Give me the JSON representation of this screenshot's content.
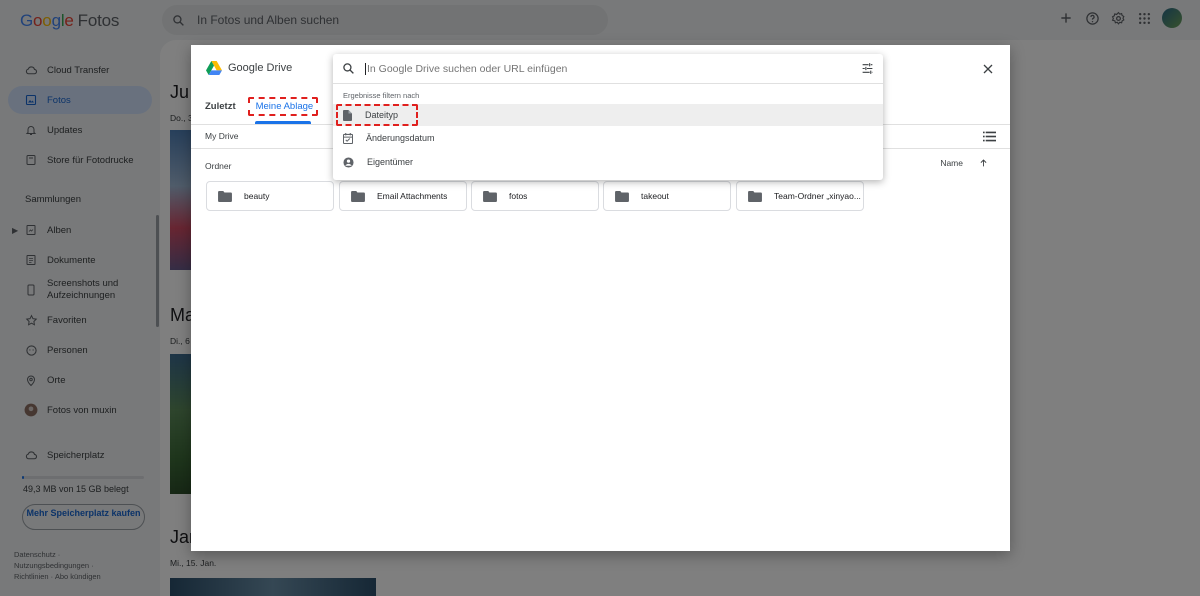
{
  "app": {
    "logo_letters": [
      "G",
      "o",
      "o",
      "g",
      "l",
      "e"
    ],
    "logo_product": "Fotos",
    "search_placeholder": "In Fotos und Alben suchen"
  },
  "sidebar": {
    "items": [
      {
        "label": "Cloud Transfer",
        "icon": "cloud-icon"
      },
      {
        "label": "Fotos",
        "icon": "photo-icon",
        "active": true
      },
      {
        "label": "Updates",
        "icon": "bell-icon"
      },
      {
        "label": "Store für Fotodrucke",
        "icon": "store-icon"
      }
    ],
    "collections_header": "Sammlungen",
    "collections": [
      {
        "label": "Alben",
        "icon": "album-icon"
      },
      {
        "label": "Dokumente",
        "icon": "document-icon"
      },
      {
        "label": "Screenshots und Aufzeichnungen",
        "icon": "phone-icon"
      },
      {
        "label": "Favoriten",
        "icon": "star-icon"
      },
      {
        "label": "Personen",
        "icon": "face-icon"
      },
      {
        "label": "Orte",
        "icon": "location-icon"
      },
      {
        "label": "Fotos von muxin",
        "icon": "avatar-icon"
      }
    ],
    "storage_label": "Speicherplatz",
    "storage_used": "49,3 MB von 15 GB belegt",
    "storage_fraction": 0.003,
    "buy_button": "Mehr Speicherplatz kaufen",
    "footer": [
      "Datenschutz ·",
      "Nutzungsbedingungen ·",
      "Richtlinien · Abo kündigen"
    ]
  },
  "timeline": [
    {
      "month": "Ju",
      "date": "Do., 3"
    },
    {
      "month": "Ma",
      "date": "Di., 6"
    },
    {
      "month": "Jan",
      "date": "Mi., 15. Jan."
    }
  ],
  "picker": {
    "brand": "Google Drive",
    "tabs": [
      "Zuletzt",
      "Meine Ablage"
    ],
    "active_tab": "Meine Ablage",
    "breadcrumb": "My Drive",
    "section": "Ordner",
    "sort_label": "Name",
    "folders": [
      "beauty",
      "Email Attachments",
      "fotos",
      "takeout",
      "Team-Ordner „xinyao..."
    ],
    "search_placeholder": "In Google Drive suchen oder URL einfügen",
    "filter_header": "Ergebnisse filtern nach",
    "filters": [
      {
        "label": "Dateityp",
        "icon": "file-icon"
      },
      {
        "label": "Änderungsdatum",
        "icon": "calendar-icon"
      },
      {
        "label": "Eigentümer",
        "icon": "account-circle-icon"
      }
    ]
  },
  "colors": {
    "accent": "#1a73e8",
    "highlight": "#e0201e",
    "sidebar_active": "#d2e3fc"
  }
}
